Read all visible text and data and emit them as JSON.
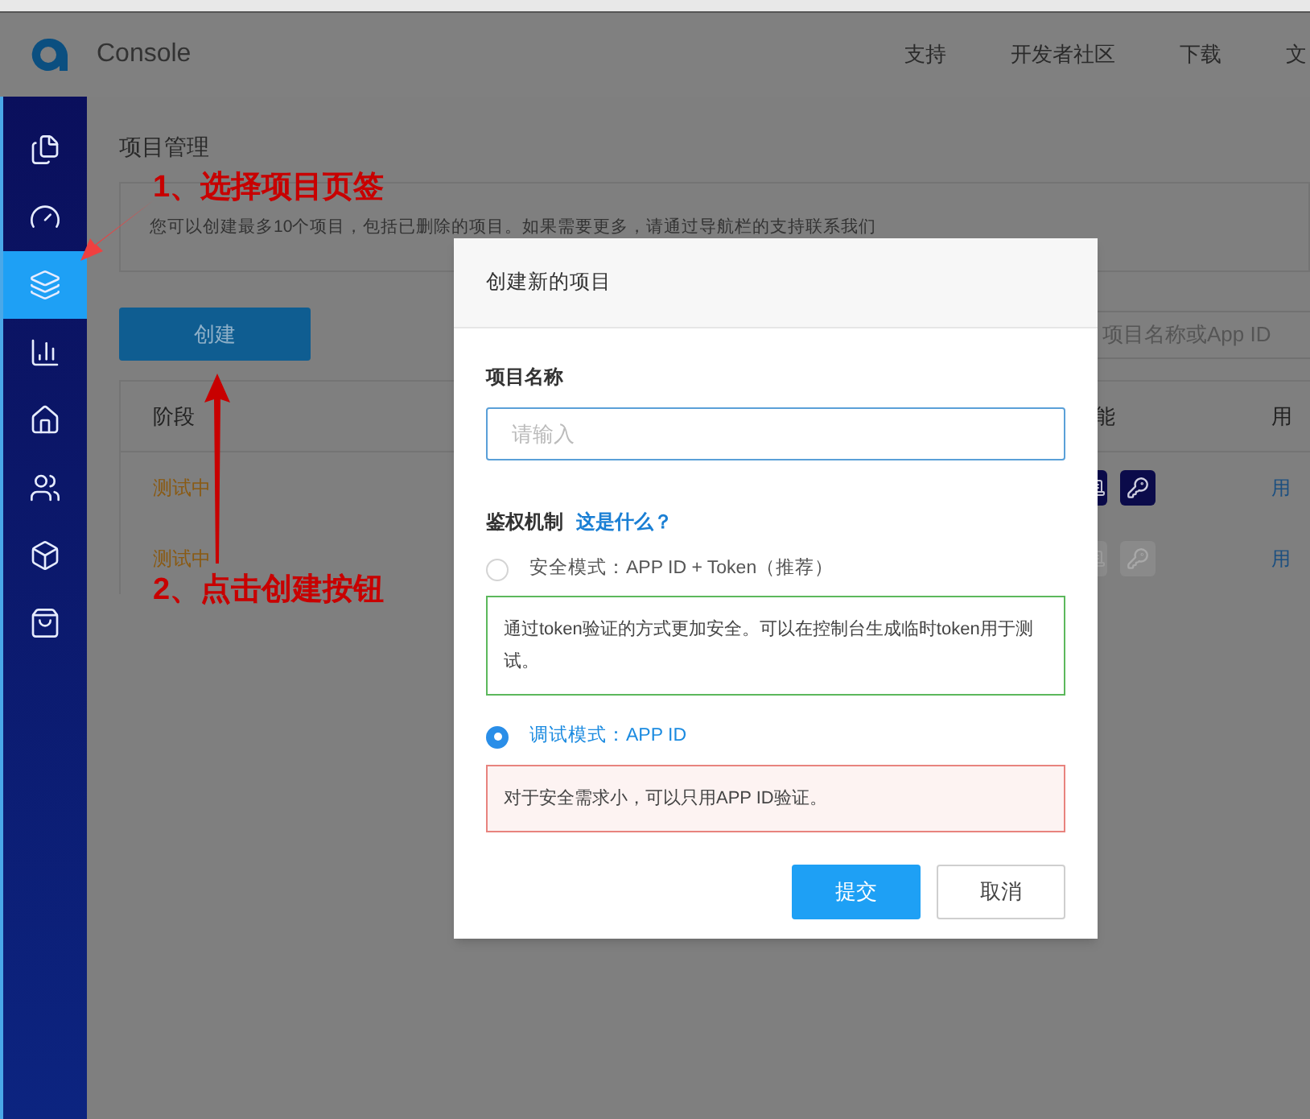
{
  "header": {
    "brand": "Console",
    "nav": [
      "支持",
      "开发者社区",
      "下载",
      "文"
    ]
  },
  "sidebar": {
    "items": [
      {
        "kind": "docs",
        "selected": false
      },
      {
        "kind": "gauge",
        "selected": false
      },
      {
        "kind": "layers",
        "selected": true
      },
      {
        "kind": "chart",
        "selected": false
      },
      {
        "kind": "house",
        "selected": false
      },
      {
        "kind": "users",
        "selected": false
      },
      {
        "kind": "box",
        "selected": false
      },
      {
        "kind": "bag",
        "selected": false
      }
    ]
  },
  "page": {
    "title": "项目管理",
    "notice": "您可以创建最多10个项目，包括已删除的项目。如果需要更多，请通过导航栏的支持联系我们",
    "create_button": "创建",
    "search_placeholder": "项目名称或App ID",
    "table": {
      "columns": [
        "阶段",
        "能",
        "用"
      ],
      "rows": [
        {
          "stage": "测试中",
          "disabled": false,
          "link": "用"
        },
        {
          "stage": "测试中",
          "disabled": true,
          "link": "用"
        }
      ]
    }
  },
  "modal": {
    "title": "创建新的项目",
    "name_label": "项目名称",
    "name_placeholder": "请输入",
    "auth_label": "鉴权机制",
    "auth_help": "这是什么？",
    "options": [
      {
        "label": "安全模式：APP ID + Token（推荐）",
        "selected": false,
        "description": "通过token验证的方式更加安全。可以在控制台生成临时token用于测试。",
        "color": "#5cb85c"
      },
      {
        "label": "调试模式：APP ID",
        "selected": true,
        "description": "对于安全需求小，可以只用APP ID验证。",
        "color": "#e8837e"
      }
    ],
    "buttons": [
      {
        "kind": "primary",
        "label": "提交"
      },
      {
        "kind": "secondary",
        "label": "取消"
      }
    ]
  },
  "annotations": [
    {
      "kind": "select-tab",
      "text": "1、选择项目页签"
    },
    {
      "kind": "click-create",
      "text": "2、点击创建按钮"
    }
  ]
}
